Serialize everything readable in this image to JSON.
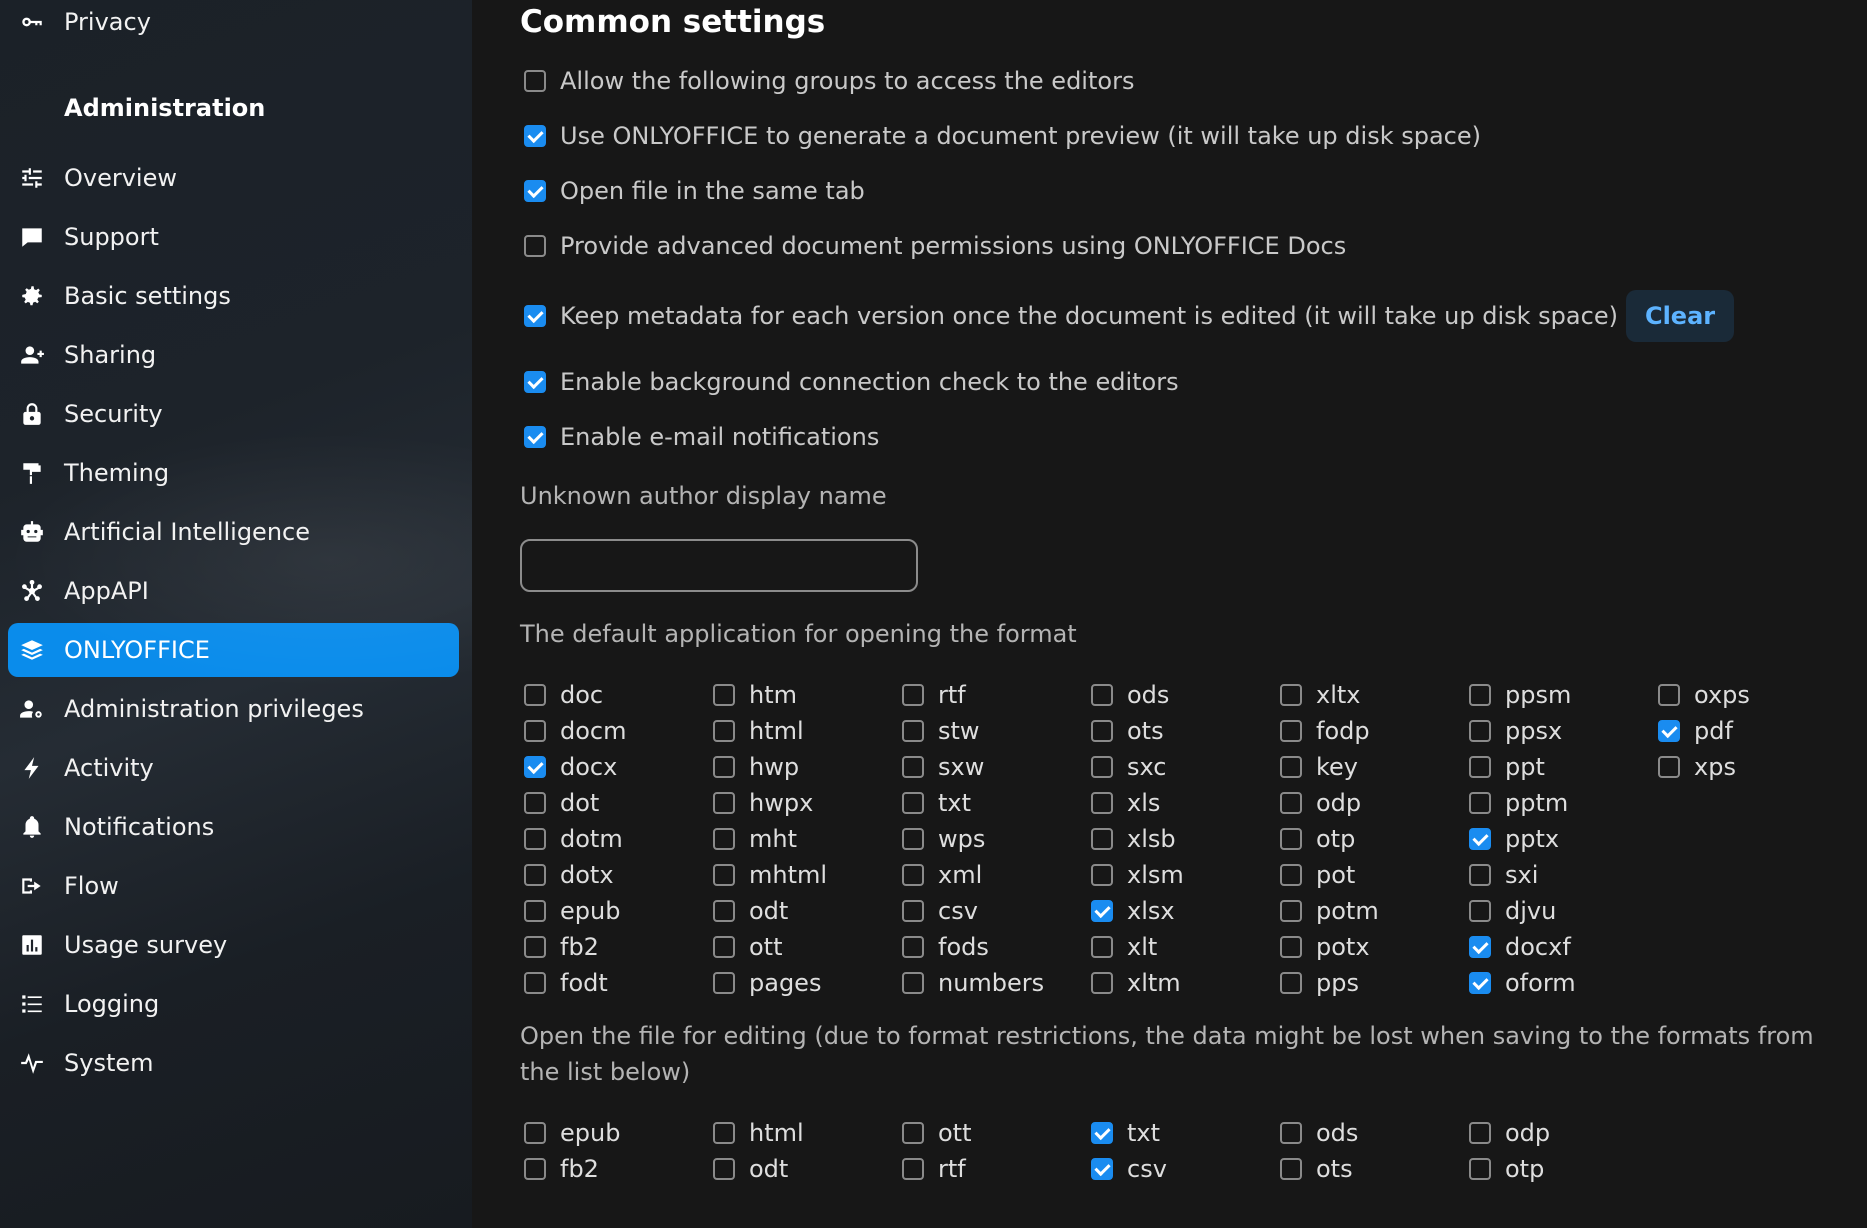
{
  "sidebar": {
    "top_item": {
      "label": "Privacy",
      "icon": "key-icon"
    },
    "section_heading": "Administration",
    "items": [
      {
        "label": "Overview",
        "icon": "sliders-icon",
        "active": false
      },
      {
        "label": "Support",
        "icon": "chat-icon",
        "active": false
      },
      {
        "label": "Basic settings",
        "icon": "gear-icon",
        "active": false
      },
      {
        "label": "Sharing",
        "icon": "share-user-icon",
        "active": false
      },
      {
        "label": "Security",
        "icon": "lock-icon",
        "active": false
      },
      {
        "label": "Theming",
        "icon": "paint-roller-icon",
        "active": false
      },
      {
        "label": "Artificial Intelligence",
        "icon": "robot-icon",
        "active": false
      },
      {
        "label": "AppAPI",
        "icon": "asterisk-icon",
        "active": false
      },
      {
        "label": "ONLYOFFICE",
        "icon": "layers-icon",
        "active": true
      },
      {
        "label": "Administration privileges",
        "icon": "user-gear-icon",
        "active": false
      },
      {
        "label": "Activity",
        "icon": "lightning-icon",
        "active": false
      },
      {
        "label": "Notifications",
        "icon": "bell-icon",
        "active": false
      },
      {
        "label": "Flow",
        "icon": "flow-icon",
        "active": false
      },
      {
        "label": "Usage survey",
        "icon": "chart-icon",
        "active": false
      },
      {
        "label": "Logging",
        "icon": "list-icon",
        "active": false
      },
      {
        "label": "System",
        "icon": "pulse-icon",
        "active": false
      }
    ],
    "active_color": "#0a8ceb"
  },
  "main": {
    "title": "Common settings",
    "options": [
      {
        "label": "Allow the following groups to access the editors",
        "checked": false
      },
      {
        "label": "Use ONLYOFFICE to generate a document preview (it will take up disk space)",
        "checked": true
      },
      {
        "label": "Open file in the same tab",
        "checked": true
      },
      {
        "label": "Provide advanced document permissions using ONLYOFFICE Docs",
        "checked": false
      },
      {
        "label": "Keep metadata for each version once the document is edited (it will take up disk space)",
        "checked": true
      },
      {
        "label": "Enable background connection check to the editors",
        "checked": true
      },
      {
        "label": "Enable e-mail notifications",
        "checked": true
      }
    ],
    "clear_label": "Clear",
    "unknown_author_label": "Unknown author display name",
    "unknown_author_value": "",
    "default_app_label": "The default application for opening the format",
    "default_formats": [
      [
        {
          "n": "doc",
          "c": false
        },
        {
          "n": "docm",
          "c": false
        },
        {
          "n": "docx",
          "c": true
        },
        {
          "n": "dot",
          "c": false
        },
        {
          "n": "dotm",
          "c": false
        },
        {
          "n": "dotx",
          "c": false
        },
        {
          "n": "epub",
          "c": false
        },
        {
          "n": "fb2",
          "c": false
        },
        {
          "n": "fodt",
          "c": false
        }
      ],
      [
        {
          "n": "htm",
          "c": false
        },
        {
          "n": "html",
          "c": false
        },
        {
          "n": "hwp",
          "c": false
        },
        {
          "n": "hwpx",
          "c": false
        },
        {
          "n": "mht",
          "c": false
        },
        {
          "n": "mhtml",
          "c": false
        },
        {
          "n": "odt",
          "c": false
        },
        {
          "n": "ott",
          "c": false
        },
        {
          "n": "pages",
          "c": false
        }
      ],
      [
        {
          "n": "rtf",
          "c": false
        },
        {
          "n": "stw",
          "c": false
        },
        {
          "n": "sxw",
          "c": false
        },
        {
          "n": "txt",
          "c": false
        },
        {
          "n": "wps",
          "c": false
        },
        {
          "n": "xml",
          "c": false
        },
        {
          "n": "csv",
          "c": false
        },
        {
          "n": "fods",
          "c": false
        },
        {
          "n": "numbers",
          "c": false
        }
      ],
      [
        {
          "n": "ods",
          "c": false
        },
        {
          "n": "ots",
          "c": false
        },
        {
          "n": "sxc",
          "c": false
        },
        {
          "n": "xls",
          "c": false
        },
        {
          "n": "xlsb",
          "c": false
        },
        {
          "n": "xlsm",
          "c": false
        },
        {
          "n": "xlsx",
          "c": true
        },
        {
          "n": "xlt",
          "c": false
        },
        {
          "n": "xltm",
          "c": false
        }
      ],
      [
        {
          "n": "xltx",
          "c": false
        },
        {
          "n": "fodp",
          "c": false
        },
        {
          "n": "key",
          "c": false
        },
        {
          "n": "odp",
          "c": false
        },
        {
          "n": "otp",
          "c": false
        },
        {
          "n": "pot",
          "c": false
        },
        {
          "n": "potm",
          "c": false
        },
        {
          "n": "potx",
          "c": false
        },
        {
          "n": "pps",
          "c": false
        }
      ],
      [
        {
          "n": "ppsm",
          "c": false
        },
        {
          "n": "ppsx",
          "c": false
        },
        {
          "n": "ppt",
          "c": false
        },
        {
          "n": "pptm",
          "c": false
        },
        {
          "n": "pptx",
          "c": true
        },
        {
          "n": "sxi",
          "c": false
        },
        {
          "n": "djvu",
          "c": false
        },
        {
          "n": "docxf",
          "c": true
        },
        {
          "n": "oform",
          "c": true
        }
      ],
      [
        {
          "n": "oxps",
          "c": false
        },
        {
          "n": "pdf",
          "c": true
        },
        {
          "n": "xps",
          "c": false
        }
      ]
    ],
    "editing_label": "Open the file for editing (due to format restrictions, the data might be lost when saving to the formats from the list below)",
    "edit_formats": [
      [
        {
          "n": "epub",
          "c": false
        },
        {
          "n": "fb2",
          "c": false
        }
      ],
      [
        {
          "n": "html",
          "c": false
        },
        {
          "n": "odt",
          "c": false
        }
      ],
      [
        {
          "n": "ott",
          "c": false
        },
        {
          "n": "rtf",
          "c": false
        }
      ],
      [
        {
          "n": "txt",
          "c": true
        },
        {
          "n": "csv",
          "c": true
        }
      ],
      [
        {
          "n": "ods",
          "c": false
        },
        {
          "n": "ots",
          "c": false
        }
      ],
      [
        {
          "n": "odp",
          "c": false
        },
        {
          "n": "otp",
          "c": false
        }
      ]
    ],
    "checkbox_color": "#1a8cf0"
  }
}
